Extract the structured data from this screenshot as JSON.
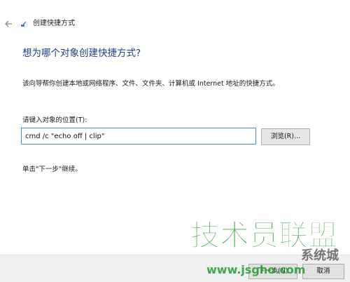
{
  "window": {
    "title": "创建快捷方式"
  },
  "page": {
    "heading": "想为哪个对象创建快捷方式?",
    "description": "该向导帮你创建本地或网络程序、文件、文件夹、计算机或 Internet 地址的快捷方式。",
    "field_label": "请键入对象的位置(T):",
    "location_value": "cmd /c \"echo off | clip\"",
    "browse_label": "浏览(R)...",
    "hint": "单击\"下一步\"继续。"
  },
  "footer": {
    "next_label": "下一步(N)",
    "cancel_label": "取消"
  },
  "watermark": {
    "brand_text": "技术员联盟",
    "url_text": "www.jsgho.com",
    "extra_text": "系统城"
  },
  "icons": {
    "back": "back-arrow-icon",
    "app": "shortcut-icon"
  },
  "colors": {
    "heading": "#1f3f8a",
    "input_border": "#4d8ad6",
    "watermark_green": "#2e9e3a"
  }
}
